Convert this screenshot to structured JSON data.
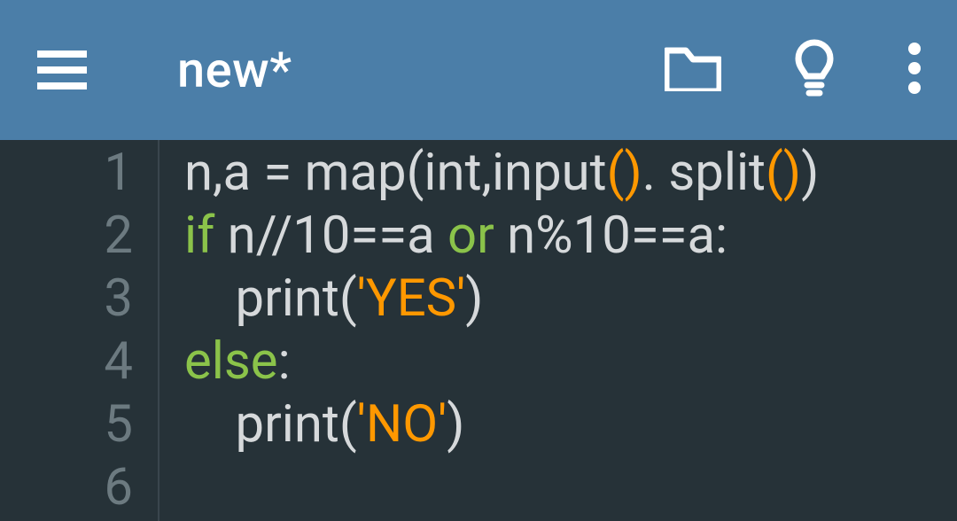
{
  "toolbar": {
    "title": "new*"
  },
  "code": {
    "line_numbers": [
      "1",
      "2",
      "3",
      "4",
      "5",
      "6"
    ],
    "lines": [
      [
        {
          "t": "n,a = map(int,input",
          "c": ""
        },
        {
          "t": "()",
          "c": "tok-paren-hl"
        },
        {
          "t": ". split",
          "c": ""
        },
        {
          "t": "()",
          "c": "tok-paren-hl"
        },
        {
          "t": ")",
          "c": ""
        }
      ],
      [
        {
          "t": "if",
          "c": "tok-kw"
        },
        {
          "t": " n//10==a ",
          "c": ""
        },
        {
          "t": "or",
          "c": "tok-kw"
        },
        {
          "t": " n%10==a:",
          "c": ""
        }
      ],
      [
        {
          "t": "    print(",
          "c": ""
        },
        {
          "t": "'YES'",
          "c": "tok-str"
        },
        {
          "t": ")",
          "c": ""
        }
      ],
      [
        {
          "t": "else",
          "c": "tok-kw"
        },
        {
          "t": ":",
          "c": ""
        }
      ],
      [
        {
          "t": "    print(",
          "c": ""
        },
        {
          "t": "'NO'",
          "c": "tok-str"
        },
        {
          "t": ")",
          "c": ""
        }
      ],
      []
    ]
  }
}
